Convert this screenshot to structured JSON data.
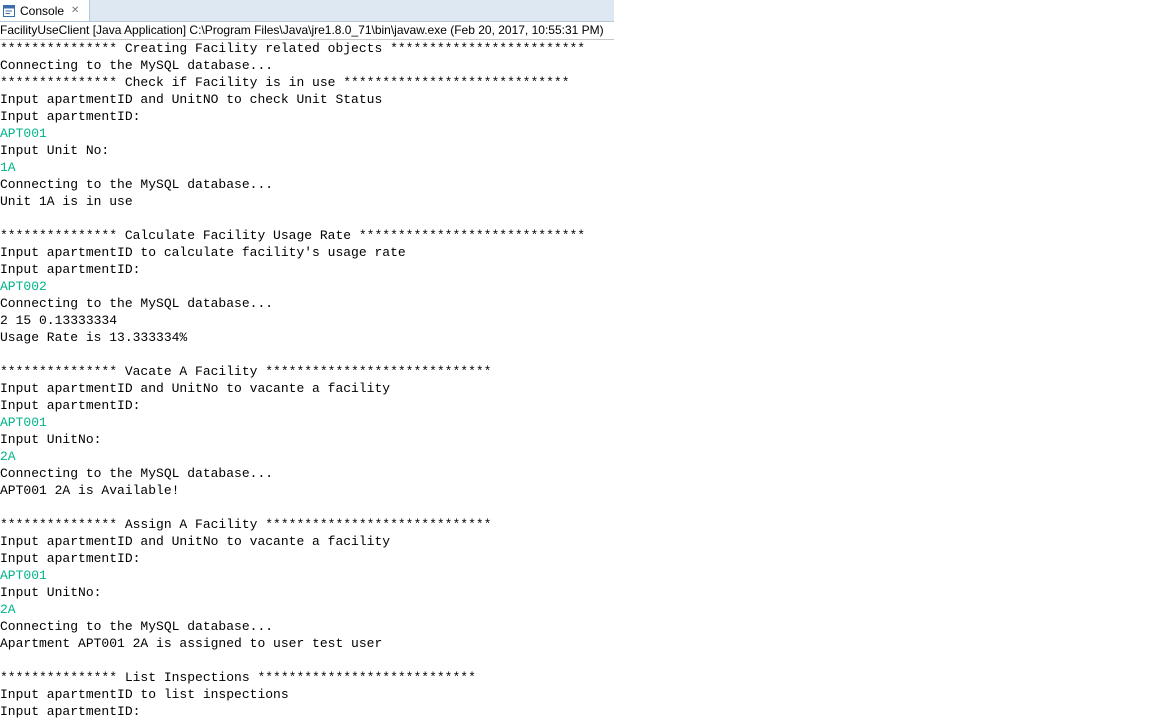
{
  "tab": {
    "label": "Console",
    "icon": "console-icon",
    "close_icon": "close-icon",
    "close_symbol": "✕"
  },
  "launch_description": "FacilityUseClient [Java Application] C:\\Program Files\\Java\\jre1.8.0_71\\bin\\javaw.exe (Feb 20, 2017, 10:55:31 PM)",
  "colors": {
    "stdin": "#00b48a",
    "stdout": "#000000",
    "tabbar_bg": "#dde8f3"
  },
  "console": {
    "lines": [
      {
        "text": "*************** Creating Facility related objects *************************",
        "type": "out"
      },
      {
        "text": "Connecting to the MySQL database...",
        "type": "out"
      },
      {
        "text": "*************** Check if Facility is in use *****************************",
        "type": "out"
      },
      {
        "text": "Input apartmentID and UnitNO to check Unit Status",
        "type": "out"
      },
      {
        "text": "Input apartmentID:",
        "type": "out"
      },
      {
        "text": "APT001",
        "type": "in"
      },
      {
        "text": "Input Unit No:",
        "type": "out"
      },
      {
        "text": "1A",
        "type": "in"
      },
      {
        "text": "Connecting to the MySQL database...",
        "type": "out"
      },
      {
        "text": "Unit 1A is in use",
        "type": "out"
      },
      {
        "text": "",
        "type": "out"
      },
      {
        "text": "*************** Calculate Facility Usage Rate *****************************",
        "type": "out"
      },
      {
        "text": "Input apartmentID to calculate facility's usage rate",
        "type": "out"
      },
      {
        "text": "Input apartmentID:",
        "type": "out"
      },
      {
        "text": "APT002",
        "type": "in"
      },
      {
        "text": "Connecting to the MySQL database...",
        "type": "out"
      },
      {
        "text": "2 15 0.13333334",
        "type": "out"
      },
      {
        "text": "Usage Rate is 13.333334%",
        "type": "out"
      },
      {
        "text": "",
        "type": "out"
      },
      {
        "text": "*************** Vacate A Facility *****************************",
        "type": "out"
      },
      {
        "text": "Input apartmentID and UnitNo to vacante a facility",
        "type": "out"
      },
      {
        "text": "Input apartmentID:",
        "type": "out"
      },
      {
        "text": "APT001",
        "type": "in"
      },
      {
        "text": "Input UnitNo:",
        "type": "out"
      },
      {
        "text": "2A",
        "type": "in"
      },
      {
        "text": "Connecting to the MySQL database...",
        "type": "out"
      },
      {
        "text": "APT001 2A is Available!",
        "type": "out"
      },
      {
        "text": "",
        "type": "out"
      },
      {
        "text": "*************** Assign A Facility *****************************",
        "type": "out"
      },
      {
        "text": "Input apartmentID and UnitNo to vacante a facility",
        "type": "out"
      },
      {
        "text": "Input apartmentID:",
        "type": "out"
      },
      {
        "text": "APT001",
        "type": "in"
      },
      {
        "text": "Input UnitNo:",
        "type": "out"
      },
      {
        "text": "2A",
        "type": "in"
      },
      {
        "text": "Connecting to the MySQL database...",
        "type": "out"
      },
      {
        "text": "Apartment APT001 2A is assigned to user test user",
        "type": "out"
      },
      {
        "text": "",
        "type": "out"
      },
      {
        "text": "*************** List Inspections ****************************",
        "type": "out"
      },
      {
        "text": "Input apartmentID to list inspections",
        "type": "out"
      },
      {
        "text": "Input apartmentID:",
        "type": "out"
      }
    ]
  }
}
